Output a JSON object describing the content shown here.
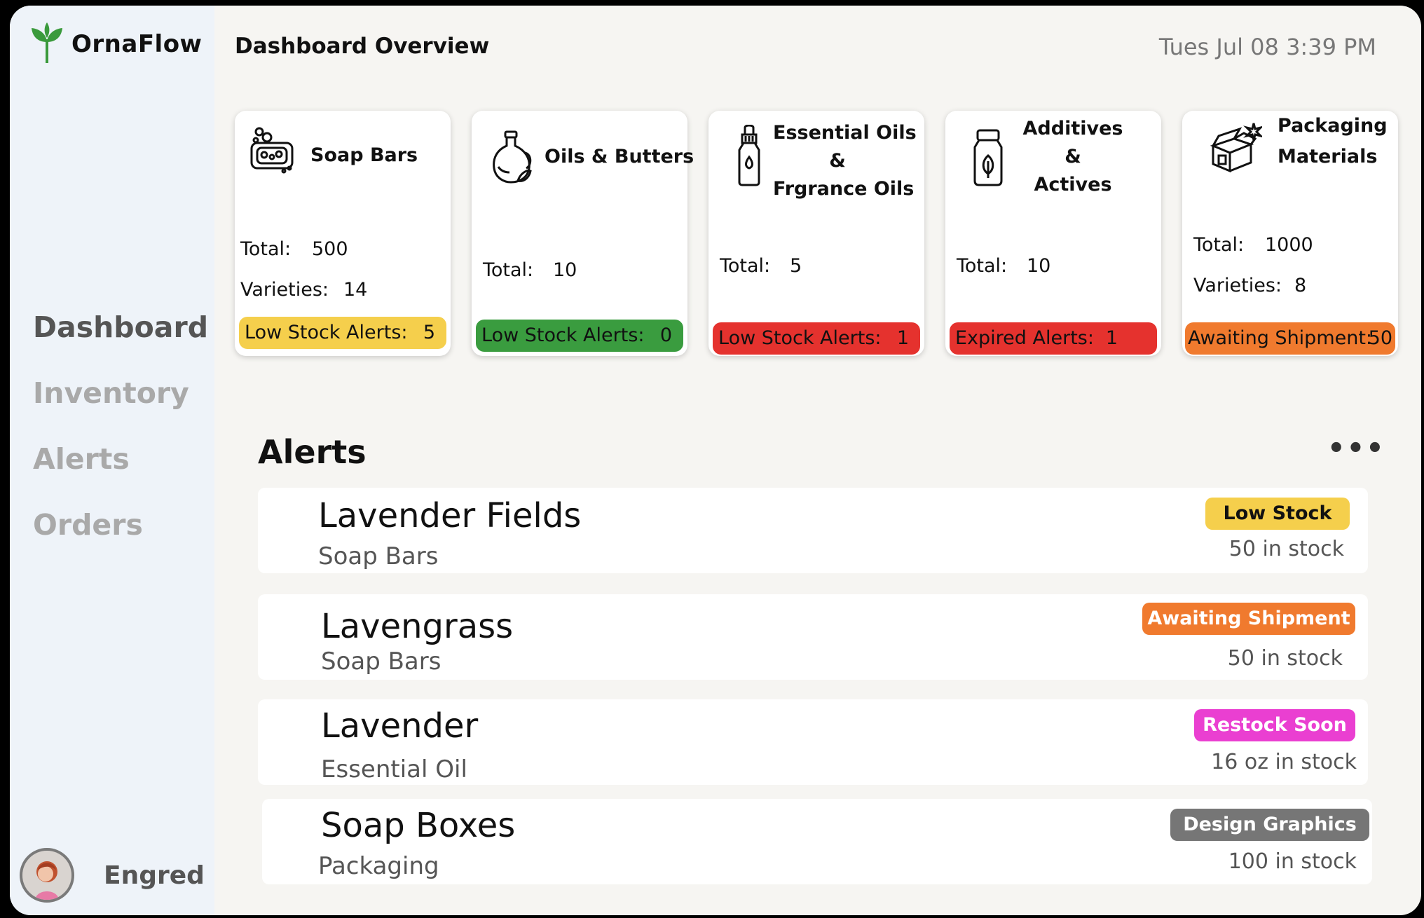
{
  "app": {
    "name": "OrnaFlow"
  },
  "header": {
    "title": "Dashboard Overview",
    "datetime": "Tues Jul 08 3:39 PM"
  },
  "nav": {
    "items": [
      {
        "label": "Dashboard",
        "active": true
      },
      {
        "label": "Inventory",
        "active": false
      },
      {
        "label": "Alerts",
        "active": false
      },
      {
        "label": "Orders",
        "active": false
      }
    ]
  },
  "user": {
    "name": "Engred"
  },
  "cards": [
    {
      "icon": "soap-bar-icon",
      "title": "Soap Bars",
      "total_label": "Total:",
      "total": "500",
      "varieties_label": "Varieties:",
      "varieties": "14",
      "alert_label": "Low Stock Alerts:",
      "alert_value": "5",
      "alert_color": "#f5cf4c"
    },
    {
      "icon": "oil-jug-icon",
      "title": "Oils & Butters",
      "total_label": "Total:",
      "total": "10",
      "alert_label": "Low Stock Alerts:",
      "alert_value": "0",
      "alert_color": "#3a9c3f"
    },
    {
      "icon": "dropper-bottle-icon",
      "title_lines": [
        "Essential Oils",
        "&",
        "Frgrance Oils"
      ],
      "total_label": "Total:",
      "total": "5",
      "alert_label": "Low Stock Alerts:",
      "alert_value": "1",
      "alert_color": "#e5322e"
    },
    {
      "icon": "leaf-jar-icon",
      "title_lines": [
        "Additives",
        "&",
        "Actives"
      ],
      "total_label": "Total:",
      "total": "10",
      "alert_label": "Expired Alerts:",
      "alert_value": "1",
      "alert_color": "#e5322e"
    },
    {
      "icon": "open-box-icon",
      "title_lines": [
        "Packaging",
        "Materials"
      ],
      "total_label": "Total:",
      "total": "1000",
      "varieties_label": "Varieties:",
      "varieties": "8",
      "alert_label": "Awaiting Shipment:",
      "alert_value": "50",
      "alert_color": "#f07a2e"
    }
  ],
  "alerts": {
    "title": "Alerts",
    "more_icon": "more-horizontal-icon",
    "items": [
      {
        "name": "Lavender Fields",
        "category": "Soap Bars",
        "badge": "Low Stock",
        "badge_color": "#f5cf4c",
        "stock": "50 in stock"
      },
      {
        "name": "Lavengrass",
        "category": "Soap Bars",
        "badge": "Awaiting Shipment",
        "badge_color": "#f07a2e",
        "stock": "50 in stock"
      },
      {
        "name": "Lavender",
        "category": "Essential Oil",
        "badge": "Restock Soon",
        "badge_color": "#ea3fd1",
        "stock": "16 oz in stock"
      },
      {
        "name": "Soap Boxes",
        "category": "Packaging",
        "badge": "Design Graphics",
        "badge_color": "#767676",
        "stock": "100 in stock"
      }
    ]
  }
}
